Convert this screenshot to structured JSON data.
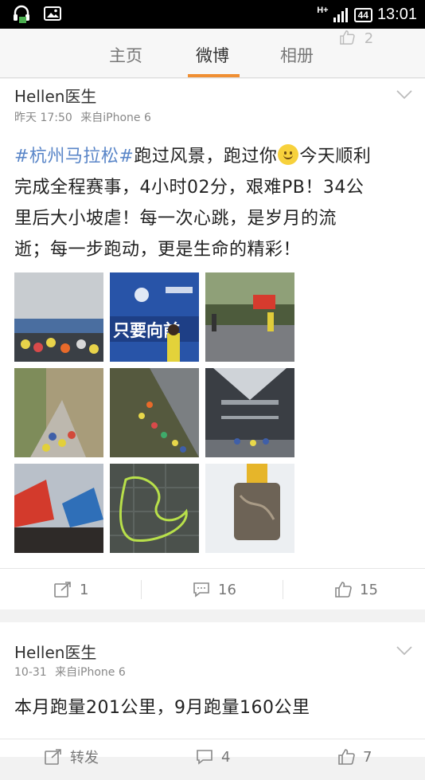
{
  "status_bar": {
    "network": "H+",
    "battery": "44",
    "time": "13:01"
  },
  "tabs": [
    {
      "label": "主页"
    },
    {
      "label": "微博"
    },
    {
      "label": "相册"
    }
  ],
  "ghost_like_count": "2",
  "posts": [
    {
      "author": "Hellen医生",
      "time": "昨天 17:50",
      "source": "来自iPhone 6",
      "hashtag": "#杭州马拉松#",
      "line1_a": "跑过风景，跑过你",
      "line1_b": "今天顺利",
      "line2": "完成全程赛事，4小时02分，艰难PB！34公",
      "line3": "里后大小坡虐！每一次心跳，是岁月的流",
      "line4": "逝；每一步跑动，更是生命的精彩！",
      "repost_count": "1",
      "comment_count": "16",
      "like_count": "15"
    },
    {
      "author": "Hellen医生",
      "time": "10-31",
      "source": "来自iPhone 6",
      "text": "本月跑量201公里，9月跑量160公里",
      "repost_label": "转发",
      "comment_count": "4",
      "like_count": "7"
    }
  ],
  "photo_banner_text": "只要向前",
  "colors": {
    "accent": "#f08f33",
    "link": "#5a86c8",
    "background": "#f2f2f2"
  }
}
